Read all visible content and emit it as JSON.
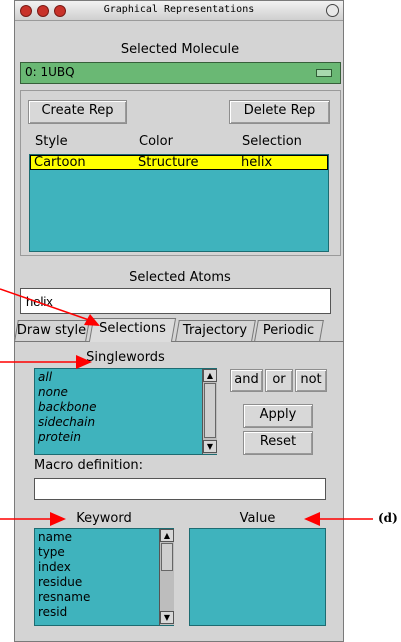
{
  "window": {
    "title": "Graphical Representations"
  },
  "molecule": {
    "header": "Selected Molecule",
    "selected": "0: 1UBQ"
  },
  "reps": {
    "create_label": "Create Rep",
    "delete_label": "Delete Rep",
    "columns": [
      "Style",
      "Color",
      "Selection"
    ],
    "rows": [
      {
        "style": "Cartoon",
        "color": "Structure",
        "selection": "helix"
      }
    ]
  },
  "selected_atoms": {
    "header": "Selected Atoms",
    "value": "helix"
  },
  "tabs": [
    "Draw style",
    "Selections",
    "Trajectory",
    "Periodic"
  ],
  "active_tab": "Selections",
  "singlewords": {
    "header": "Singlewords",
    "items": [
      "all",
      "none",
      "backbone",
      "sidechain",
      "protein"
    ]
  },
  "logic_buttons": {
    "and": "and",
    "or": "or",
    "not": "not"
  },
  "actions": {
    "apply": "Apply",
    "reset": "Reset"
  },
  "macro": {
    "label": "Macro definition:",
    "value": ""
  },
  "keyword": {
    "header": "Keyword",
    "items": [
      "name",
      "type",
      "index",
      "residue",
      "resname",
      "resid"
    ]
  },
  "value_panel": {
    "header": "Value"
  },
  "annotations": {
    "d_label": "(d)"
  },
  "colors": {
    "list_cyan": "#3fb3bd",
    "molecule_green": "#6ab874",
    "selected_row_yellow": "#ffff00",
    "arrow_red": "#ff0000"
  }
}
